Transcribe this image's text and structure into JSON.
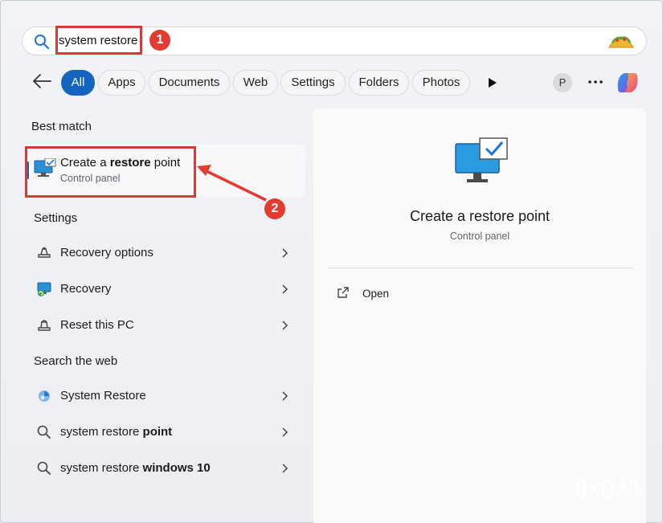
{
  "search": {
    "query": "system restore"
  },
  "annotations": {
    "badge1": "1",
    "badge2": "2"
  },
  "filters": {
    "tabs": [
      {
        "label": "All"
      },
      {
        "label": "Apps"
      },
      {
        "label": "Documents"
      },
      {
        "label": "Web"
      },
      {
        "label": "Settings"
      },
      {
        "label": "Folders"
      },
      {
        "label": "Photos"
      }
    ],
    "avatar_letter": "P"
  },
  "best_match": {
    "heading": "Best match",
    "title_pre": "Create a ",
    "title_bold": "restore",
    "title_post": " point",
    "subtitle": "Control panel"
  },
  "settings_section": {
    "heading": "Settings",
    "items": [
      {
        "label": "Recovery options",
        "icon": "recovery-options-icon"
      },
      {
        "label": "Recovery",
        "icon": "recovery-icon"
      },
      {
        "label": "Reset this PC",
        "icon": "reset-pc-icon"
      }
    ]
  },
  "web_section": {
    "heading": "Search the web",
    "items": [
      {
        "pre": "System Restore",
        "bold": "",
        "icon": "web-result-icon"
      },
      {
        "pre": "system restore ",
        "bold": "point",
        "icon": "search-icon"
      },
      {
        "pre": "system restore ",
        "bold": "windows 10",
        "icon": "search-icon"
      }
    ]
  },
  "preview": {
    "title": "Create a restore point",
    "subtitle": "Control panel",
    "action_open": "Open"
  },
  "colors": {
    "accent": "#1565c0",
    "annotation": "#d83a3a"
  }
}
